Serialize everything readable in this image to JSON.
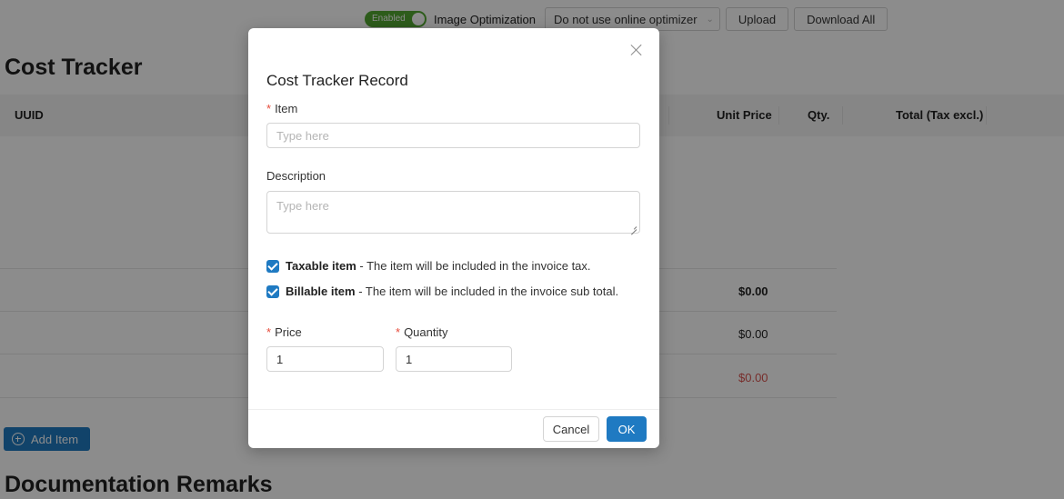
{
  "toolbar": {
    "toggle_label": "Enabled",
    "image_optimization_label": "Image Optimization",
    "optimizer_select_value": "Do not use online optimizer",
    "upload_label": "Upload",
    "download_all_label": "Download All"
  },
  "page": {
    "cost_tracker_title": "Cost Tracker",
    "documentation_title": "Documentation Remarks"
  },
  "table": {
    "headers": {
      "uuid": "UUID",
      "unit_price": "Unit Price",
      "qty": "Qty.",
      "total": "Total (Tax excl.)"
    },
    "summary_values": [
      "$0.00",
      "$0.00",
      "$0.00"
    ]
  },
  "add_item_label": "Add Item",
  "modal": {
    "title": "Cost Tracker Record",
    "item_label": "Item",
    "item_placeholder": "Type here",
    "description_label": "Description",
    "description_placeholder": "Type here",
    "taxable_bold": "Taxable item",
    "taxable_text": " - The item will be included in the invoice tax.",
    "billable_bold": "Billable item",
    "billable_text": " - The item will be included in the invoice sub total.",
    "price_label": "Price",
    "price_value": "1",
    "quantity_label": "Quantity",
    "quantity_value": "1",
    "cancel_label": "Cancel",
    "ok_label": "OK",
    "required_mark": "*"
  },
  "colors": {
    "accent": "#1f7ac2",
    "toggle_on": "#52a832",
    "required": "#e74c3c",
    "negative": "#d9534f"
  }
}
